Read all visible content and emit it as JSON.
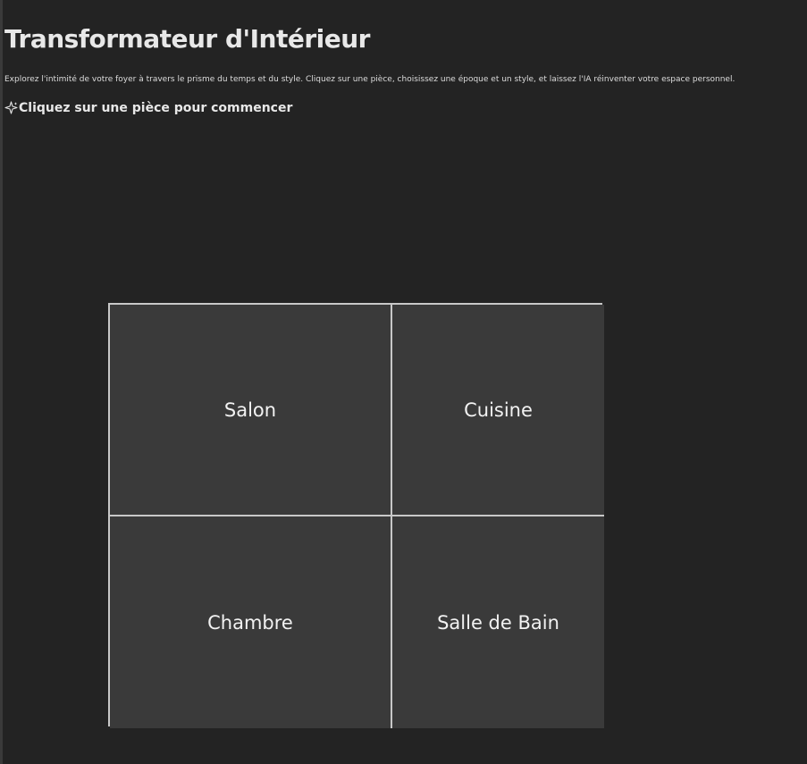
{
  "page": {
    "title": "Transformateur d'Intérieur",
    "intro": "Explorez l'intimité de votre foyer à travers le prisme du temps et du style. Cliquez sur une pièce, choisissez une époque et un style, et laissez l'IA réinventer votre espace personnel.",
    "prompt": "Cliquez sur une pièce pour commencer",
    "prompt_icon": "sparkle-icon"
  },
  "rooms": [
    {
      "label": "Salon"
    },
    {
      "label": "Cuisine"
    },
    {
      "label": "Chambre"
    },
    {
      "label": "Salle de Bain"
    }
  ],
  "colors": {
    "background": "#232323",
    "room_fill": "#3a3a3a",
    "room_border": "#c8c8c8",
    "text": "#e8e8e8"
  }
}
